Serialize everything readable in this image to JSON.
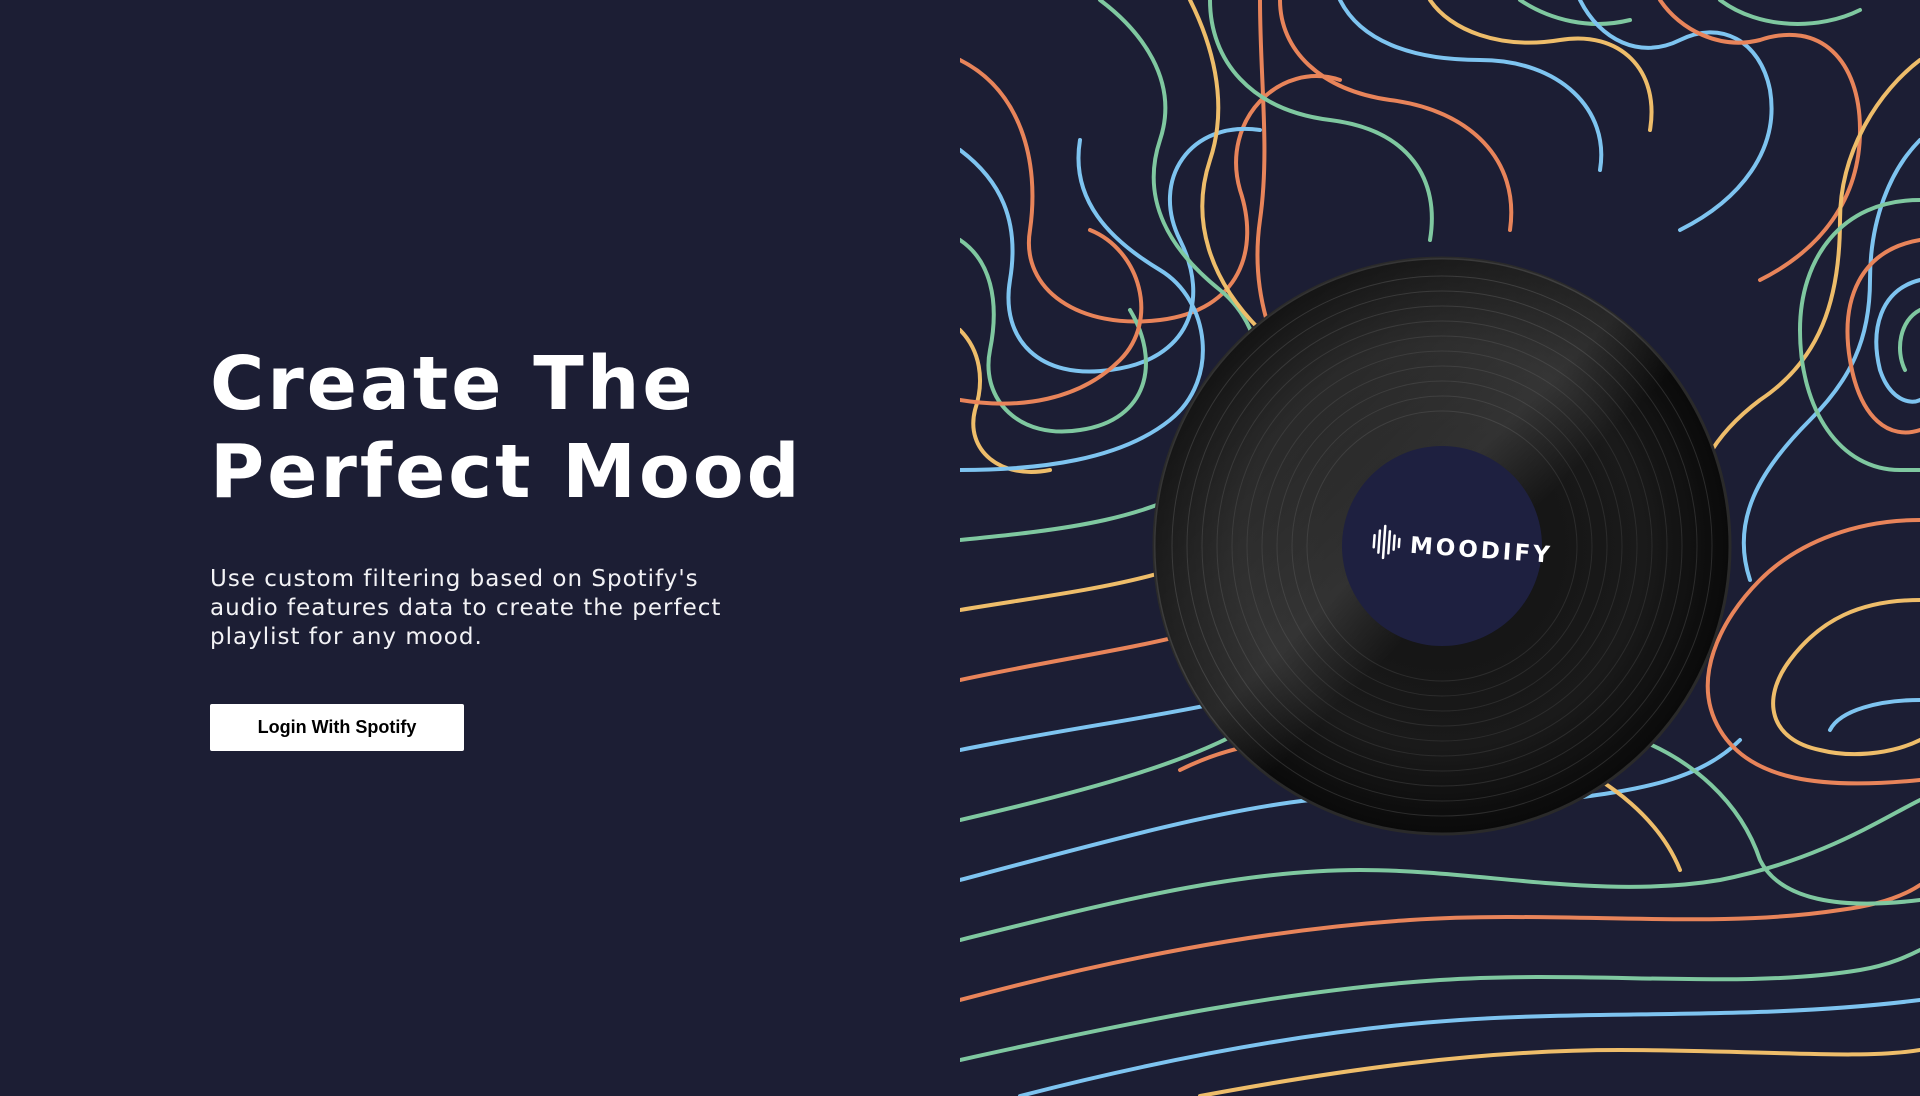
{
  "hero": {
    "title_line1": "Create The",
    "title_line2": "Perfect Mood",
    "description": "Use custom filtering based on Spotify's audio features data to create the perfect playlist for any mood.",
    "login_label": "Login With Spotify"
  },
  "record": {
    "label_text": "MOODIFY",
    "label_icon": "soundwave-icon"
  },
  "colors": {
    "background": "#1c1e34",
    "wave_orange": "#e8845a",
    "wave_green": "#7fc8a0",
    "wave_blue": "#7ec4f0",
    "wave_yellow": "#eebd6a",
    "label_background": "#1e2040"
  }
}
